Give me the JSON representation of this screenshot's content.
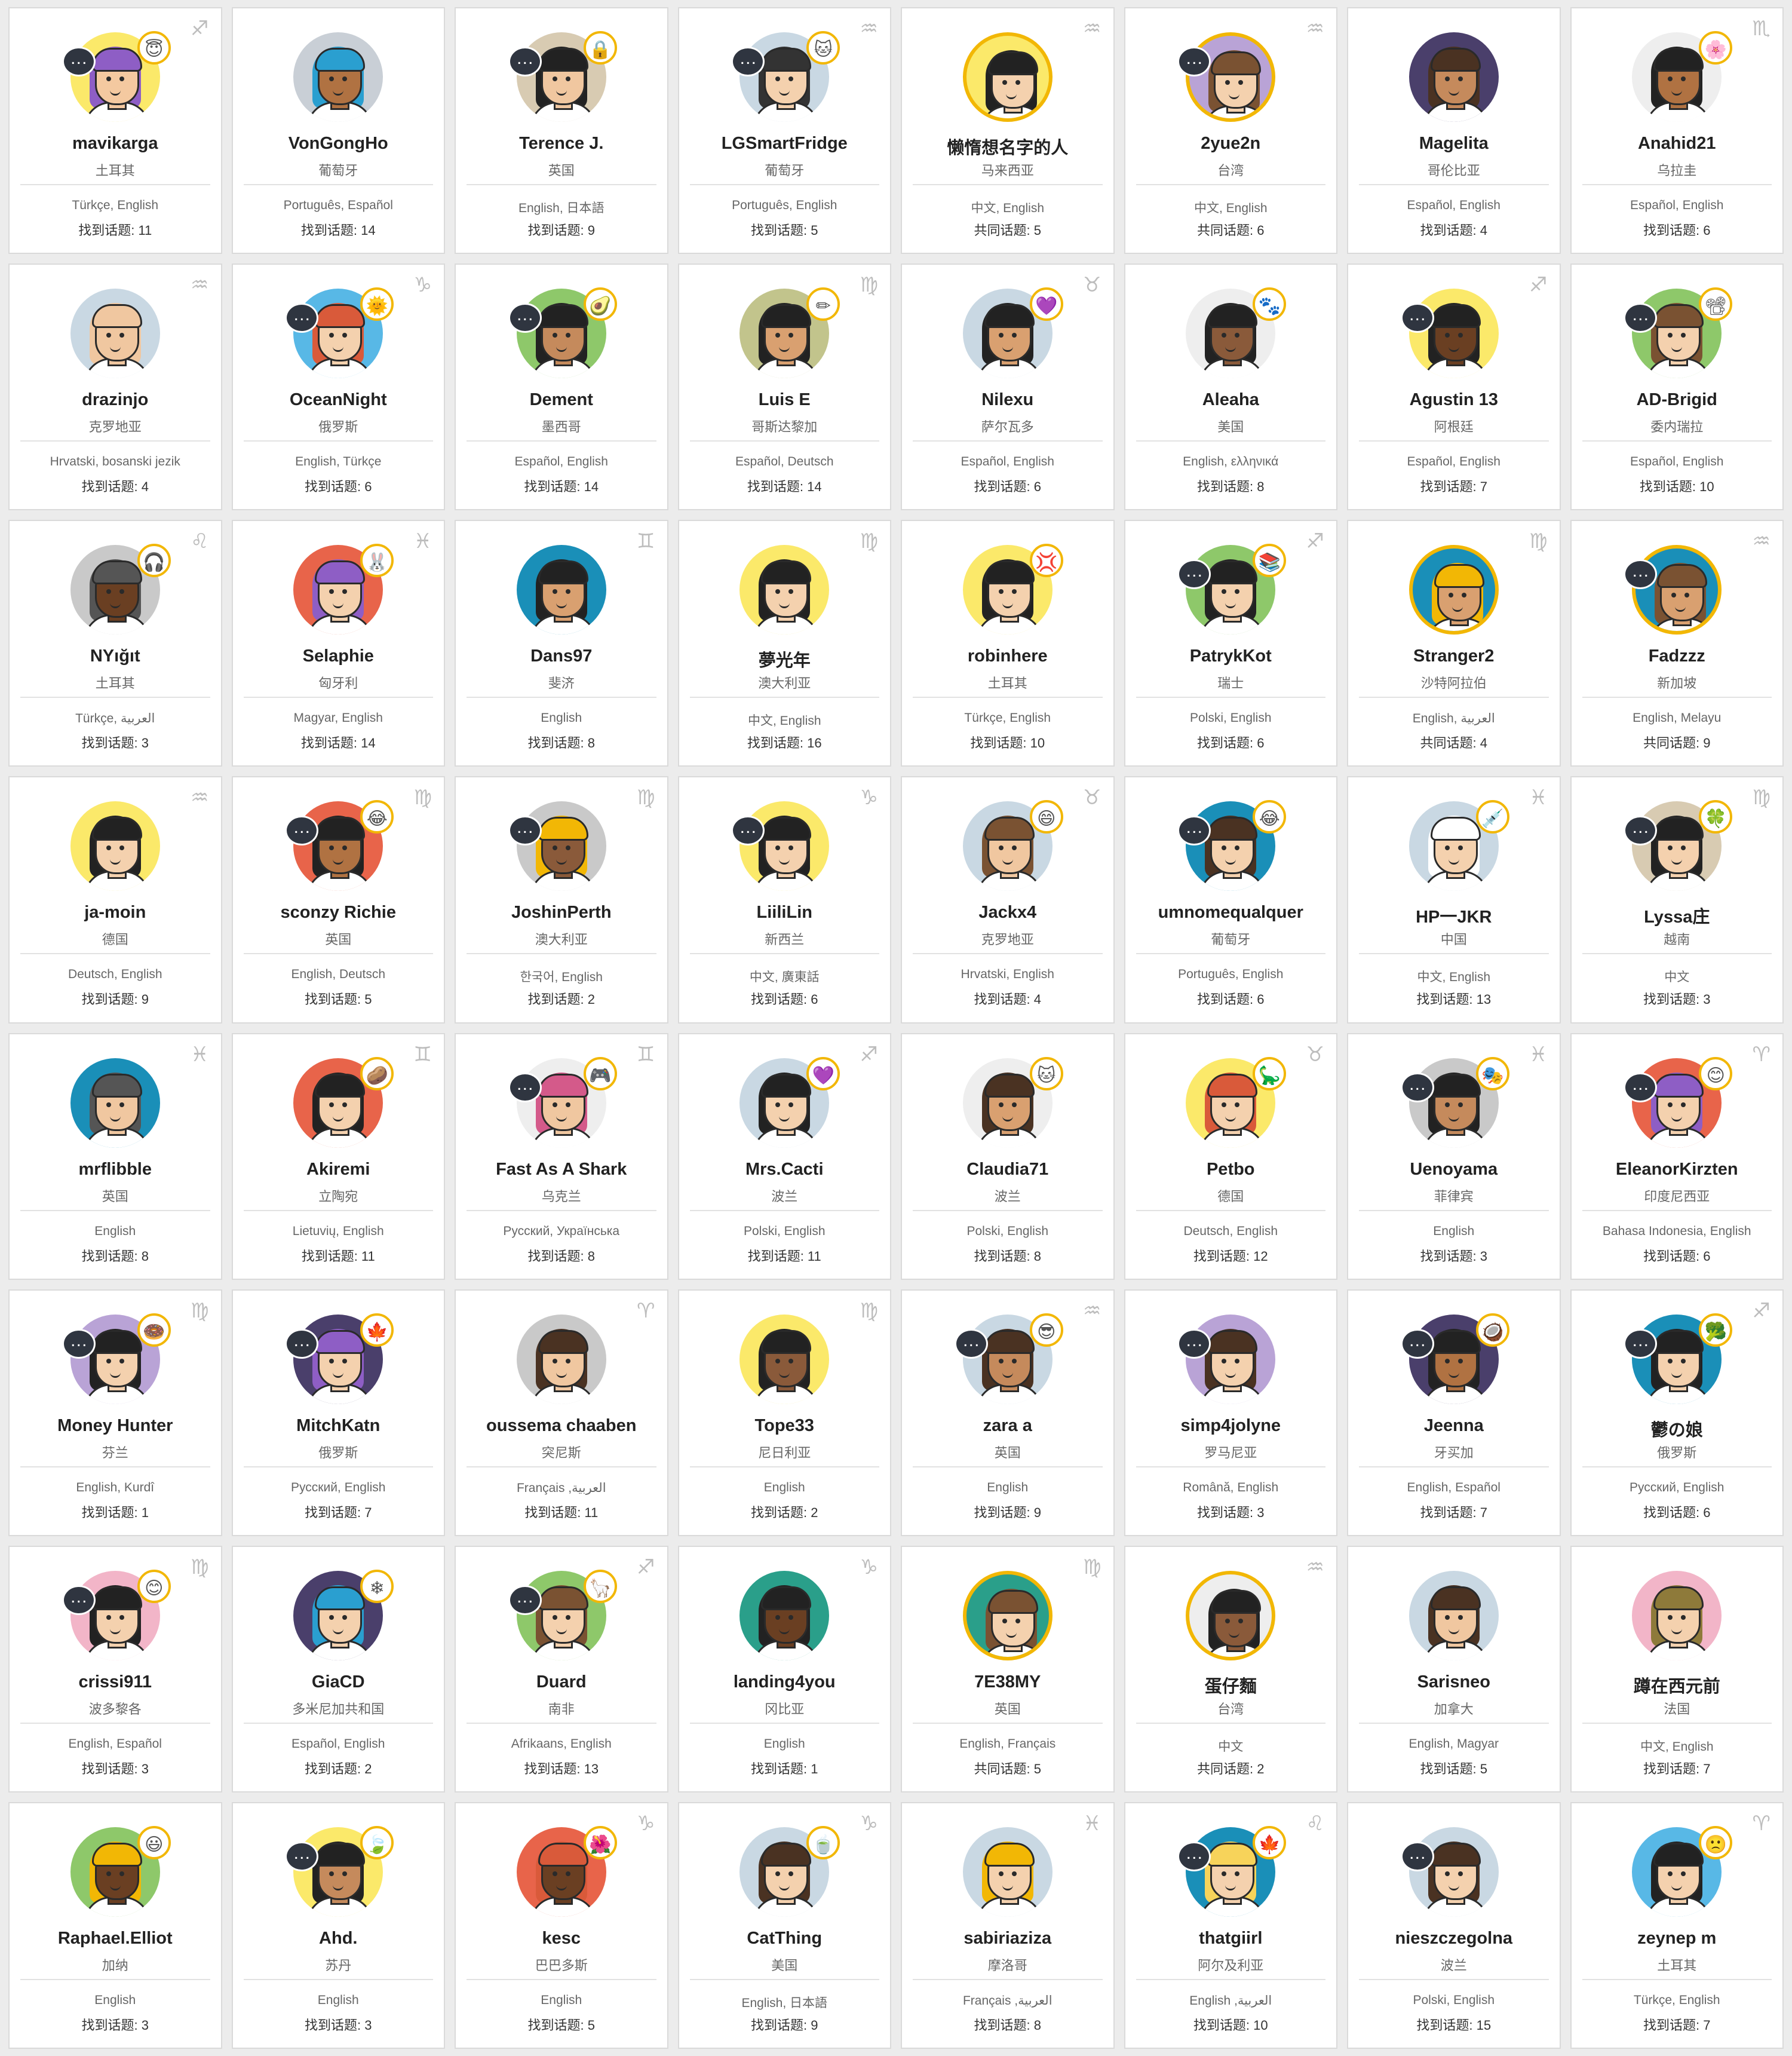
{
  "colors": {
    "page_background": "#ececec",
    "card_background": "#ffffff",
    "accent_ring": "#f2b705",
    "chat_badge": "#2f3540"
  },
  "users": [
    {
      "name": "mavikarga",
      "country": "土耳其",
      "languages": "Türkçe, English",
      "topics": "找到话题: 11",
      "zodiac": "♐",
      "bg": "#fbe96a",
      "skin": "#f4c9a0",
      "hair": "#8e5ec5",
      "chat": true,
      "emoji": "😇"
    },
    {
      "name": "VonGongHo",
      "country": "葡萄牙",
      "languages": "Português, Español",
      "topics": "找到话题: 14",
      "zodiac": "",
      "bg": "#c9cfd6",
      "skin": "#b07242",
      "hair": "#2a9fd0",
      "chat": false,
      "emoji": ""
    },
    {
      "name": "Terence J.",
      "country": "英国",
      "languages": "English, 日本語",
      "topics": "找到话题: 9",
      "zodiac": "",
      "bg": "#d8cbb2",
      "skin": "#f0c7a0",
      "hair": "#222222",
      "chat": true,
      "emoji": "🔒"
    },
    {
      "name": "LGSmartFridge",
      "country": "葡萄牙",
      "languages": "Português, English",
      "topics": "找到话题: 5",
      "zodiac": "♒",
      "bg": "#c9d8e3",
      "skin": "#f4d1ae",
      "hair": "#333333",
      "chat": true,
      "emoji": "🐱"
    },
    {
      "name": "懒惰想名字的人",
      "country": "马来西亚",
      "languages": "中文, English",
      "topics": "共同话题: 5",
      "zodiac": "♒",
      "bg": "#fbe96a",
      "skin": "#f4d1ae",
      "hair": "#222222",
      "chat": false,
      "emoji": "",
      "ring": true
    },
    {
      "name": "2yue2n",
      "country": "台湾",
      "languages": "中文, English",
      "topics": "共同话题: 6",
      "zodiac": "♒",
      "bg": "#b9a3d6",
      "skin": "#f4d1ae",
      "hair": "#7a5232",
      "chat": true,
      "emoji": "",
      "ring": true
    },
    {
      "name": "Magelita",
      "country": "哥伦比亚",
      "languages": "Español, English",
      "topics": "找到话题: 4",
      "zodiac": "",
      "bg": "#4a3f6b",
      "skin": "#c58a5c",
      "hair": "#4a3222",
      "chat": false,
      "emoji": ""
    },
    {
      "name": "Anahid21",
      "country": "乌拉圭",
      "languages": "Español, English",
      "topics": "找到话题: 6",
      "zodiac": "♏",
      "bg": "#eeeeee",
      "skin": "#b07242",
      "hair": "#222222",
      "chat": false,
      "emoji": "🌸"
    },
    {
      "name": "drazinjo",
      "country": "克罗地亚",
      "languages": "Hrvatski, bosanski jezik",
      "topics": "找到话题: 4",
      "zodiac": "♒",
      "bg": "#c9d8e3",
      "skin": "#f0c7a0",
      "hair": "#f0c7a0",
      "chat": false,
      "emoji": ""
    },
    {
      "name": "OceanNight",
      "country": "俄罗斯",
      "languages": "English, Türkçe",
      "topics": "找到话题: 6",
      "zodiac": "♑",
      "bg": "#58b8e6",
      "skin": "#f4d1ae",
      "hair": "#d95a3a",
      "chat": true,
      "emoji": "🌞"
    },
    {
      "name": "Dement",
      "country": "墨西哥",
      "languages": "Español, English",
      "topics": "找到话题: 14",
      "zodiac": "",
      "bg": "#8ec86a",
      "skin": "#c58a5c",
      "hair": "#222222",
      "chat": true,
      "emoji": "🥑"
    },
    {
      "name": "Luis E",
      "country": "哥斯达黎加",
      "languages": "Español, Deutsch",
      "topics": "找到话题: 14",
      "zodiac": "♍",
      "bg": "#c2c48c",
      "skin": "#d9a070",
      "hair": "#222222",
      "chat": false,
      "emoji": "✏"
    },
    {
      "name": "Nilexu",
      "country": "萨尔瓦多",
      "languages": "Español, English",
      "topics": "找到话题: 6",
      "zodiac": "♉",
      "bg": "#c9d8e3",
      "skin": "#d9a070",
      "hair": "#222222",
      "chat": false,
      "emoji": "💜"
    },
    {
      "name": "Aleaha",
      "country": "美国",
      "languages": "English, ελληνικά",
      "topics": "找到话题: 8",
      "zodiac": "",
      "bg": "#eeeeee",
      "skin": "#8a5a3a",
      "hair": "#222222",
      "chat": false,
      "emoji": "🐾"
    },
    {
      "name": "Agustin 13",
      "country": "阿根廷",
      "languages": "Español, English",
      "topics": "找到话题: 7",
      "zodiac": "♐",
      "bg": "#fbe96a",
      "skin": "#6a3f22",
      "hair": "#222222",
      "chat": true,
      "emoji": ""
    },
    {
      "name": "AD-Brigid",
      "country": "委内瑞拉",
      "languages": "Español, English",
      "topics": "找到话题: 10",
      "zodiac": "",
      "bg": "#8ec86a",
      "skin": "#f4d1ae",
      "hair": "#7a5232",
      "chat": true,
      "emoji": "📽"
    },
    {
      "name": "NYığıt",
      "country": "土耳其",
      "languages": "Türkçe, العربية",
      "topics": "找到话题: 3",
      "zodiac": "♌",
      "bg": "#c9c9c9",
      "skin": "#6a3f22",
      "hair": "#555555",
      "chat": false,
      "emoji": "🎧"
    },
    {
      "name": "Selaphie",
      "country": "匈牙利",
      "languages": "Magyar, English",
      "topics": "找到话题: 14",
      "zodiac": "♓",
      "bg": "#e8644a",
      "skin": "#f4d1ae",
      "hair": "#8e5ec5",
      "chat": false,
      "emoji": "🐰"
    },
    {
      "name": "Dans97",
      "country": "斐济",
      "languages": "English",
      "topics": "找到话题: 8",
      "zodiac": "♊",
      "bg": "#1a8fb8",
      "skin": "#d9a070",
      "hair": "#222222",
      "chat": false,
      "emoji": ""
    },
    {
      "name": "夢光年",
      "country": "澳大利亚",
      "languages": "中文, English",
      "topics": "找到话题: 16",
      "zodiac": "♍",
      "bg": "#fbe96a",
      "skin": "#f4d1ae",
      "hair": "#222222",
      "chat": false,
      "emoji": ""
    },
    {
      "name": "robinhere",
      "country": "土耳其",
      "languages": "Türkçe, English",
      "topics": "找到话题: 10",
      "zodiac": "",
      "bg": "#fbe96a",
      "skin": "#f4d1ae",
      "hair": "#222222",
      "chat": false,
      "emoji": "💢"
    },
    {
      "name": "PatrykKot",
      "country": "瑞士",
      "languages": "Polski, English",
      "topics": "找到话题: 6",
      "zodiac": "♐",
      "bg": "#8ec86a",
      "skin": "#f4d1ae",
      "hair": "#222222",
      "chat": true,
      "emoji": "📚"
    },
    {
      "name": "Stranger2",
      "country": "沙特阿拉伯",
      "languages": "English, العربية",
      "topics": "共同话题: 4",
      "zodiac": "♍",
      "bg": "#1a8fb8",
      "skin": "#d9a070",
      "hair": "#f2b705",
      "chat": false,
      "emoji": "",
      "ring": true
    },
    {
      "name": "Fadzzz",
      "country": "新加坡",
      "languages": "English, Melayu",
      "topics": "共同话题: 9",
      "zodiac": "♒",
      "bg": "#1a8fb8",
      "skin": "#d9a070",
      "hair": "#7a5232",
      "chat": true,
      "emoji": "",
      "ring": true
    },
    {
      "name": "ja-moin",
      "country": "德国",
      "languages": "Deutsch, English",
      "topics": "找到话题: 9",
      "zodiac": "♒",
      "bg": "#fbe96a",
      "skin": "#f4d1ae",
      "hair": "#222222",
      "chat": false,
      "emoji": ""
    },
    {
      "name": "sconzy Richie",
      "country": "英国",
      "languages": "English, Deutsch",
      "topics": "找到话题: 5",
      "zodiac": "♍",
      "bg": "#e8644a",
      "skin": "#b07242",
      "hair": "#222222",
      "chat": true,
      "emoji": "😂"
    },
    {
      "name": "JoshinPerth",
      "country": "澳大利亚",
      "languages": "한국어, English",
      "topics": "找到话题: 2",
      "zodiac": "♍",
      "bg": "#c9c9c9",
      "skin": "#8a5a3a",
      "hair": "#f2b705",
      "chat": true,
      "emoji": ""
    },
    {
      "name": "LiiliLin",
      "country": "新西兰",
      "languages": "中文, 廣東話",
      "topics": "找到话题: 6",
      "zodiac": "♑",
      "bg": "#fbe96a",
      "skin": "#f4d1ae",
      "hair": "#222222",
      "chat": true,
      "emoji": ""
    },
    {
      "name": "Jackx4",
      "country": "克罗地亚",
      "languages": "Hrvatski, English",
      "topics": "找到话题: 4",
      "zodiac": "♉",
      "bg": "#c9d8e3",
      "skin": "#f0c7a0",
      "hair": "#7a5232",
      "chat": false,
      "emoji": "😄"
    },
    {
      "name": "umnomequalquer",
      "country": "葡萄牙",
      "languages": "Português, English",
      "topics": "找到话题: 6",
      "zodiac": "",
      "bg": "#1a8fb8",
      "skin": "#f4d1ae",
      "hair": "#4a3222",
      "chat": true,
      "emoji": "😂"
    },
    {
      "name": "HP一JKR",
      "country": "中国",
      "languages": "中文, English",
      "topics": "找到话题: 13",
      "zodiac": "♓",
      "bg": "#c9d8e3",
      "skin": "#f4d1ae",
      "hair": "#ffffff",
      "chat": false,
      "emoji": "💉"
    },
    {
      "name": "Lyssa庄",
      "country": "越南",
      "languages": "中文",
      "topics": "找到话题: 3",
      "zodiac": "♍",
      "bg": "#d8cbb2",
      "skin": "#f4d1ae",
      "hair": "#222222",
      "chat": true,
      "emoji": "🍀"
    },
    {
      "name": "mrflibble",
      "country": "英国",
      "languages": "English",
      "topics": "找到话题: 8",
      "zodiac": "♓",
      "bg": "#1a8fb8",
      "skin": "#f0c7a0",
      "hair": "#555555",
      "chat": false,
      "emoji": ""
    },
    {
      "name": "Akiremi",
      "country": "立陶宛",
      "languages": "Lietuvių, English",
      "topics": "找到话题: 11",
      "zodiac": "♊",
      "bg": "#e8644a",
      "skin": "#f4d1ae",
      "hair": "#222222",
      "chat": false,
      "emoji": "🥔"
    },
    {
      "name": "Fast As A Shark",
      "country": "乌克兰",
      "languages": "Русский, Українська",
      "topics": "找到话题: 8",
      "zodiac": "♊",
      "bg": "#eeeeee",
      "skin": "#f0c7a0",
      "hair": "#d45a8a",
      "chat": true,
      "emoji": "🎮"
    },
    {
      "name": "Mrs.Cacti",
      "country": "波兰",
      "languages": "Polski, English",
      "topics": "找到话题: 11",
      "zodiac": "♐",
      "bg": "#c9d8e3",
      "skin": "#f4d1ae",
      "hair": "#222222",
      "chat": false,
      "emoji": "💜"
    },
    {
      "name": "Claudia71",
      "country": "波兰",
      "languages": "Polski, English",
      "topics": "找到话题: 8",
      "zodiac": "",
      "bg": "#eeeeee",
      "skin": "#d9a070",
      "hair": "#4a3222",
      "chat": false,
      "emoji": "🐱"
    },
    {
      "name": "Petbo",
      "country": "德国",
      "languages": "Deutsch, English",
      "topics": "找到话题: 12",
      "zodiac": "♉",
      "bg": "#fbe96a",
      "skin": "#f4d1ae",
      "hair": "#d95a3a",
      "chat": false,
      "emoji": "🦕"
    },
    {
      "name": "Uenoyama",
      "country": "菲律宾",
      "languages": "English",
      "topics": "找到话题: 3",
      "zodiac": "♓",
      "bg": "#c9c9c9",
      "skin": "#c58a5c",
      "hair": "#222222",
      "chat": true,
      "emoji": "🎭"
    },
    {
      "name": "EleanorKirzten",
      "country": "印度尼西亚",
      "languages": "Bahasa Indonesia, English",
      "topics": "找到话题: 6",
      "zodiac": "♈",
      "bg": "#e8644a",
      "skin": "#f4d1ae",
      "hair": "#8e5ec5",
      "chat": true,
      "emoji": "😊"
    },
    {
      "name": "Money Hunter",
      "country": "芬兰",
      "languages": "English, Kurdî",
      "topics": "找到话题: 1",
      "zodiac": "♍",
      "bg": "#b9a3d6",
      "skin": "#f4d1ae",
      "hair": "#222222",
      "chat": true,
      "emoji": "🍩"
    },
    {
      "name": "MitchKatn",
      "country": "俄罗斯",
      "languages": "Русский, English",
      "topics": "找到话题: 7",
      "zodiac": "",
      "bg": "#4a3f6b",
      "skin": "#f4d1ae",
      "hair": "#8e5ec5",
      "chat": true,
      "emoji": "🍁"
    },
    {
      "name": "oussema chaaben",
      "country": "突尼斯",
      "languages": "Français ,العربية",
      "topics": "找到话题: 11",
      "zodiac": "♈",
      "bg": "#c9c9c9",
      "skin": "#f0c7a0",
      "hair": "#4a3222",
      "chat": false,
      "emoji": ""
    },
    {
      "name": "Tope33",
      "country": "尼日利亚",
      "languages": "English",
      "topics": "找到话题: 2",
      "zodiac": "♍",
      "bg": "#fbe96a",
      "skin": "#8a5a3a",
      "hair": "#222222",
      "chat": false,
      "emoji": ""
    },
    {
      "name": "zara a",
      "country": "英国",
      "languages": "English",
      "topics": "找到话题: 9",
      "zodiac": "♒",
      "bg": "#c9d8e3",
      "skin": "#c58a5c",
      "hair": "#4a3222",
      "chat": true,
      "emoji": "😎"
    },
    {
      "name": "simp4jolyne",
      "country": "罗马尼亚",
      "languages": "Română, English",
      "topics": "找到话题: 3",
      "zodiac": "",
      "bg": "#b9a3d6",
      "skin": "#f4d1ae",
      "hair": "#4a3222",
      "chat": true,
      "emoji": ""
    },
    {
      "name": "Jeenna",
      "country": "牙买加",
      "languages": "English, Español",
      "topics": "找到话题: 7",
      "zodiac": "",
      "bg": "#4a3f6b",
      "skin": "#b07242",
      "hair": "#222222",
      "chat": true,
      "emoji": "🥥"
    },
    {
      "name": "鬱の娘",
      "country": "俄罗斯",
      "languages": "Русский, English",
      "topics": "找到话题: 6",
      "zodiac": "♐",
      "bg": "#1a8fb8",
      "skin": "#f4d1ae",
      "hair": "#222222",
      "chat": true,
      "emoji": "🥦"
    },
    {
      "name": "crissi911",
      "country": "波多黎各",
      "languages": "English, Español",
      "topics": "找到话题: 3",
      "zodiac": "♍",
      "bg": "#f2b5c8",
      "skin": "#f4d1ae",
      "hair": "#222222",
      "chat": true,
      "emoji": "😊"
    },
    {
      "name": "GiaCD",
      "country": "多米尼加共和国",
      "languages": "Español, English",
      "topics": "找到话题: 2",
      "zodiac": "",
      "bg": "#4a3f6b",
      "skin": "#f4d1ae",
      "hair": "#2a9fd0",
      "chat": false,
      "emoji": "❄"
    },
    {
      "name": "Duard",
      "country": "南非",
      "languages": "Afrikaans, English",
      "topics": "找到话题: 13",
      "zodiac": "♐",
      "bg": "#8ec86a",
      "skin": "#f4d1ae",
      "hair": "#7a5232",
      "chat": true,
      "emoji": "🦙"
    },
    {
      "name": "landing4you",
      "country": "冈比亚",
      "languages": "English",
      "topics": "找到话题: 1",
      "zodiac": "♑",
      "bg": "#2a9f8a",
      "skin": "#6a3f22",
      "hair": "#222222",
      "chat": false,
      "emoji": ""
    },
    {
      "name": "7E38MY",
      "country": "英国",
      "languages": "English, Français",
      "topics": "共同话题: 5",
      "zodiac": "♍",
      "bg": "#2a9f8a",
      "skin": "#f4d1ae",
      "hair": "#7a5232",
      "chat": false,
      "emoji": "",
      "ring": true
    },
    {
      "name": "蛋仔麵",
      "country": "台湾",
      "languages": "中文",
      "topics": "共同话题: 2",
      "zodiac": "♒",
      "bg": "#eeeeee",
      "skin": "#8a5a3a",
      "hair": "#222222",
      "chat": false,
      "emoji": "",
      "ring": true
    },
    {
      "name": "Sarisneo",
      "country": "加拿大",
      "languages": "English, Magyar",
      "topics": "找到话题: 5",
      "zodiac": "",
      "bg": "#c9d8e3",
      "skin": "#f0c7a0",
      "hair": "#4a3222",
      "chat": false,
      "emoji": ""
    },
    {
      "name": "蹲在西元前",
      "country": "法国",
      "languages": "中文, English",
      "topics": "找到话题: 7",
      "zodiac": "",
      "bg": "#f2b5c8",
      "skin": "#f4d1ae",
      "hair": "#8e7a3a",
      "chat": false,
      "emoji": ""
    },
    {
      "name": "Raphael.Elliot",
      "country": "加纳",
      "languages": "English",
      "topics": "找到话题: 3",
      "zodiac": "",
      "bg": "#8ec86a",
      "skin": "#6a3f22",
      "hair": "#f2b705",
      "chat": false,
      "emoji": "😃"
    },
    {
      "name": "Ahd.",
      "country": "苏丹",
      "languages": "English",
      "topics": "找到话题: 3",
      "zodiac": "",
      "bg": "#fbe96a",
      "skin": "#c58a5c",
      "hair": "#222222",
      "chat": true,
      "emoji": "🍃"
    },
    {
      "name": "kesc",
      "country": "巴巴多斯",
      "languages": "English",
      "topics": "找到话题: 5",
      "zodiac": "♑",
      "bg": "#e8644a",
      "skin": "#6a3f22",
      "hair": "#d95a3a",
      "chat": false,
      "emoji": "🌺"
    },
    {
      "name": "CatThing",
      "country": "美国",
      "languages": "English, 日本語",
      "topics": "找到话题: 9",
      "zodiac": "♑",
      "bg": "#c9d8e3",
      "skin": "#f4d1ae",
      "hair": "#4a3222",
      "chat": false,
      "emoji": "🍵"
    },
    {
      "name": "sabiriaziza",
      "country": "摩洛哥",
      "languages": "Français ,العربية",
      "topics": "找到话题: 8",
      "zodiac": "♓",
      "bg": "#c9d8e3",
      "skin": "#f4d1ae",
      "hair": "#f2b705",
      "chat": false,
      "emoji": ""
    },
    {
      "name": "thatgiirl",
      "country": "阿尔及利亚",
      "languages": "English ,العربية",
      "topics": "找到话题: 10",
      "zodiac": "♌",
      "bg": "#1a8fb8",
      "skin": "#f4d1ae",
      "hair": "#f7d35a",
      "chat": true,
      "emoji": "🍁"
    },
    {
      "name": "nieszczegolna",
      "country": "波兰",
      "languages": "Polski, English",
      "topics": "找到话题: 15",
      "zodiac": "",
      "bg": "#c9d8e3",
      "skin": "#f4d1ae",
      "hair": "#4a3222",
      "chat": true,
      "emoji": ""
    },
    {
      "name": "zeynep m",
      "country": "土耳其",
      "languages": "Türkçe, English",
      "topics": "找到话题: 7",
      "zodiac": "♈",
      "bg": "#58b8e6",
      "skin": "#f4d1ae",
      "hair": "#222222",
      "chat": false,
      "emoji": "🙁"
    }
  ]
}
